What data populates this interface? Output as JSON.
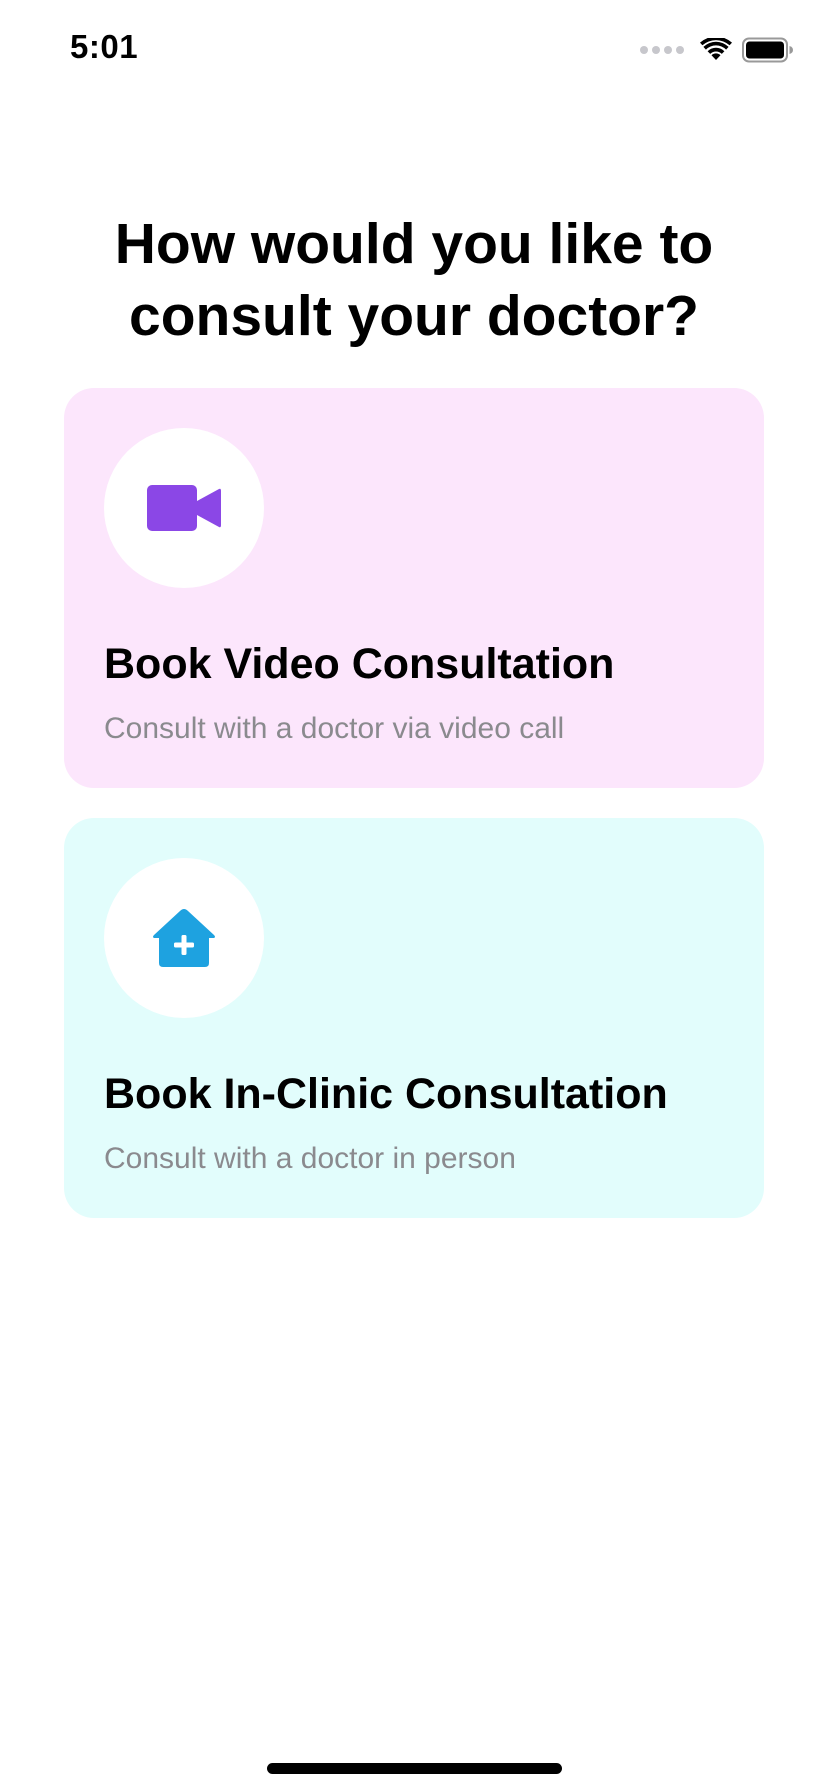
{
  "status_bar": {
    "time": "5:01",
    "icons": [
      "cellular-signal-icon",
      "wifi-icon",
      "battery-icon"
    ]
  },
  "headline": "How would you like to consult your doctor?",
  "options": [
    {
      "title": "Book Video Consultation",
      "subtitle": "Consult with a doctor via video call",
      "icon": "video-camera-icon",
      "background_color": "#fce6fc",
      "icon_color": "#8b47e6"
    },
    {
      "title": "Book In-Clinic Consultation",
      "subtitle": "Consult with a doctor in person",
      "icon": "clinic-house-icon",
      "background_color": "#e2fdfc",
      "icon_color": "#1ea2e0"
    }
  ]
}
